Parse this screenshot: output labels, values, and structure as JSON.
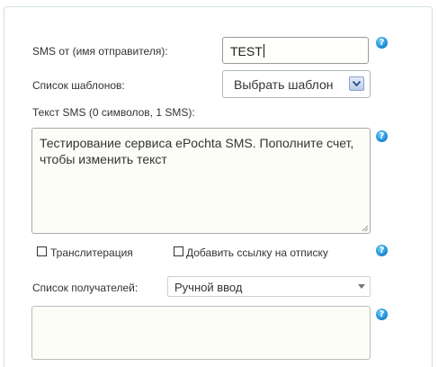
{
  "form": {
    "sender_label": "SMS от (имя отправителя):",
    "sender_value": "TEST",
    "templates_label": "Список шаблонов:",
    "templates_selected": "Выбрать шаблон",
    "sms_text_label": "Текст SMS (0 символов, 1 SMS):",
    "sms_text_value": "Тестирование сервиса ePochta SMS. Пополните счет, чтобы изменить текст",
    "transliteration_label": "Транслитерация",
    "transliteration_checked": false,
    "unsubscribe_label": "Добавить ссылку на отписку",
    "unsubscribe_checked": false,
    "recipients_label": "Список получателей:",
    "recipients_selected": "Ручной ввод",
    "recipients_value": ""
  },
  "help": {
    "glyph": "?"
  },
  "colors": {
    "accent": "#1f8fd6",
    "panel_border": "#d4dfe6",
    "field_bg": "#fdfdf7"
  }
}
